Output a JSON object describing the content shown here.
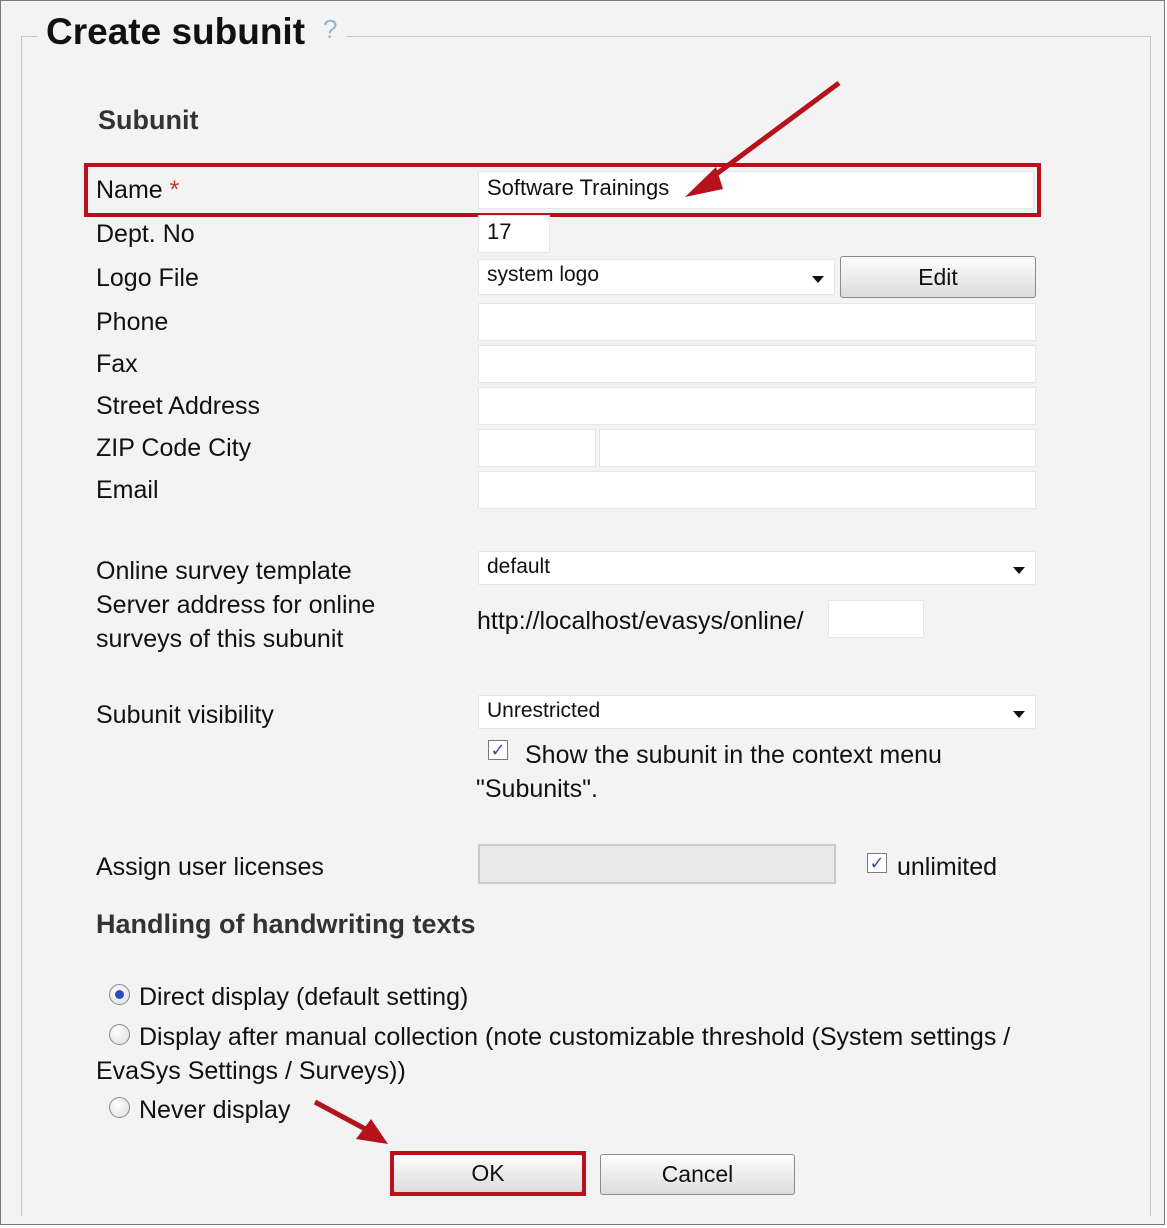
{
  "dialog": {
    "title": "Create subunit",
    "help_icon": "?"
  },
  "subunit": {
    "heading": "Subunit",
    "name": {
      "label": "Name",
      "required_marker": "*",
      "value": "Software Trainings"
    },
    "dept_no": {
      "label": "Dept. No",
      "value": "17"
    },
    "logo_file": {
      "label": "Logo File",
      "selected": "system logo",
      "edit_label": "Edit"
    },
    "phone": {
      "label": "Phone",
      "value": ""
    },
    "fax": {
      "label": "Fax",
      "value": ""
    },
    "street": {
      "label": "Street Address",
      "value": ""
    },
    "zip_city": {
      "label": "ZIP Code City",
      "zip_value": "",
      "city_value": ""
    },
    "email": {
      "label": "Email",
      "value": ""
    },
    "survey_template": {
      "label": "Online survey template",
      "selected": "default"
    },
    "server_address": {
      "label_line1": "Server address for online",
      "label_line2": "surveys of this subunit",
      "prefix": "http://localhost/evasys/online/",
      "value": ""
    },
    "visibility": {
      "label": "Subunit visibility",
      "selected": "Unrestricted",
      "show_context_checked": true,
      "show_context_line1": "Show the subunit in the context menu",
      "show_context_line2": "\"Subunits\"."
    },
    "licenses": {
      "label": "Assign user licenses",
      "unlimited_checked": true,
      "unlimited_label": "unlimited"
    }
  },
  "handwriting": {
    "heading": "Handling of handwriting texts",
    "options": [
      {
        "label": "Direct display (default setting)",
        "checked": true
      },
      {
        "label_line1": "Display after manual collection (note customizable threshold (System settings /",
        "label_line2": "EvaSys Settings / Surveys))",
        "checked": false
      },
      {
        "label": "Never display",
        "checked": false
      }
    ]
  },
  "actions": {
    "ok_label": "OK",
    "cancel_label": "Cancel"
  },
  "colors": {
    "annotation_red": "#b5121b",
    "checkbox_mark": "#3a4ea0",
    "radio_dot": "#2a4fb8"
  }
}
